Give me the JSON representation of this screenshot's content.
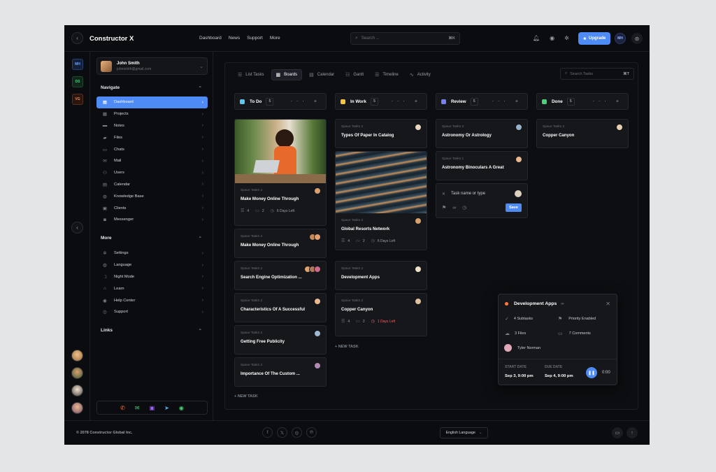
{
  "app": {
    "title": "Constructor X"
  },
  "topnav": {
    "items": [
      "Dashboard",
      "News",
      "Support",
      "More"
    ]
  },
  "search": {
    "placeholder": "Search ...",
    "shortcut": "⌘K"
  },
  "header": {
    "upgrade_label": "Upgrade",
    "user_initials": "MH"
  },
  "workspaces": [
    "MH",
    "DS",
    "VG"
  ],
  "user": {
    "name": "John Smith",
    "email": "johnsmith@gmail.com"
  },
  "sidebar": {
    "navigate_title": "Navigate",
    "navigate_items": [
      "Dashboard",
      "Projects",
      "Notes",
      "Files",
      "Chats",
      "Mail",
      "Users",
      "Calendar",
      "Knowledge Base",
      "Clients",
      "Messenger"
    ],
    "more_title": "More",
    "more_items": [
      "Settings",
      "Language",
      "Night Mode",
      "Learn",
      "Help Center",
      "Support"
    ],
    "links_title": "Links"
  },
  "tabs": [
    "List Tasks",
    "Boards",
    "Calendar",
    "Gantt",
    "Timeline",
    "Activity"
  ],
  "search_tasks": {
    "placeholder": "Search Tasks",
    "shortcut": "⌘T"
  },
  "columns": [
    {
      "name": "To Do",
      "count": "5",
      "color": "#5bc8f0"
    },
    {
      "name": "In Work",
      "count": "5",
      "color": "#f5c542"
    },
    {
      "name": "Review",
      "count": "5",
      "color": "#7b7ff5"
    },
    {
      "name": "Done",
      "count": "5",
      "color": "#4ad17a"
    }
  ],
  "cards": {
    "todo": [
      {
        "project": "Space Tasks 2",
        "title": "Make Money Online Through",
        "subtasks": "4",
        "comments": "2",
        "due": "6 Days Left"
      },
      {
        "project": "Space Tasks 2",
        "title": "Make Money Online Through"
      },
      {
        "project": "Space Tasks 2",
        "title": "Search Engine Optimization ..."
      },
      {
        "project": "Space Tasks 2",
        "title": "Characteristics Of A Successful"
      },
      {
        "project": "Space Tasks 2",
        "title": "Getting Free Publicity"
      },
      {
        "project": "Space Tasks 2",
        "title": "Importance Of The Custom ..."
      }
    ],
    "inwork": [
      {
        "project": "Space Tasks 2",
        "title": "Types Of Paper In Catalog"
      },
      {
        "project": "Space Tasks 2",
        "title": "Global Resorts Network",
        "subtasks": "4",
        "comments": "2",
        "due": "6 Days Left"
      },
      {
        "project": "Space Tasks 2",
        "title": "Development Apps"
      },
      {
        "project": "Space Tasks 2",
        "title": "Copper Canyon",
        "subtasks": "4",
        "comments": "2",
        "due": "1 Days Left"
      }
    ],
    "review": [
      {
        "project": "Space Tasks 3",
        "title": "Astronomy Or Astrology"
      },
      {
        "project": "Space Tasks 1",
        "title": "Astronomy Binoculars A Great"
      }
    ],
    "done": [
      {
        "project": "Space Tasks 2",
        "title": "Copper Canyon"
      }
    ]
  },
  "new_task_form": {
    "placeholder": "Task name or type",
    "save_label": "Save"
  },
  "new_task_label": "+ NEW TASK",
  "popup": {
    "title": "Development Apps",
    "subtasks": "4 Subtasks",
    "priority": "Priority Enabled",
    "files": "3 Files",
    "comments": "7 Comments",
    "assignee": "Tyler Norman",
    "start_label": "START DATE",
    "start_value": "Sep 3, 9:00 pm",
    "due_label": "DUE DATE",
    "due_value": "Sep 4, 9:00 pm",
    "timer": "0:00"
  },
  "footer": {
    "copyright": "© 2078 Constructor Global Inc.",
    "language": "English Language"
  },
  "colors": {
    "accent": "#4f8bf5",
    "background": "#0b0c0f",
    "danger": "#ff5b5b"
  }
}
